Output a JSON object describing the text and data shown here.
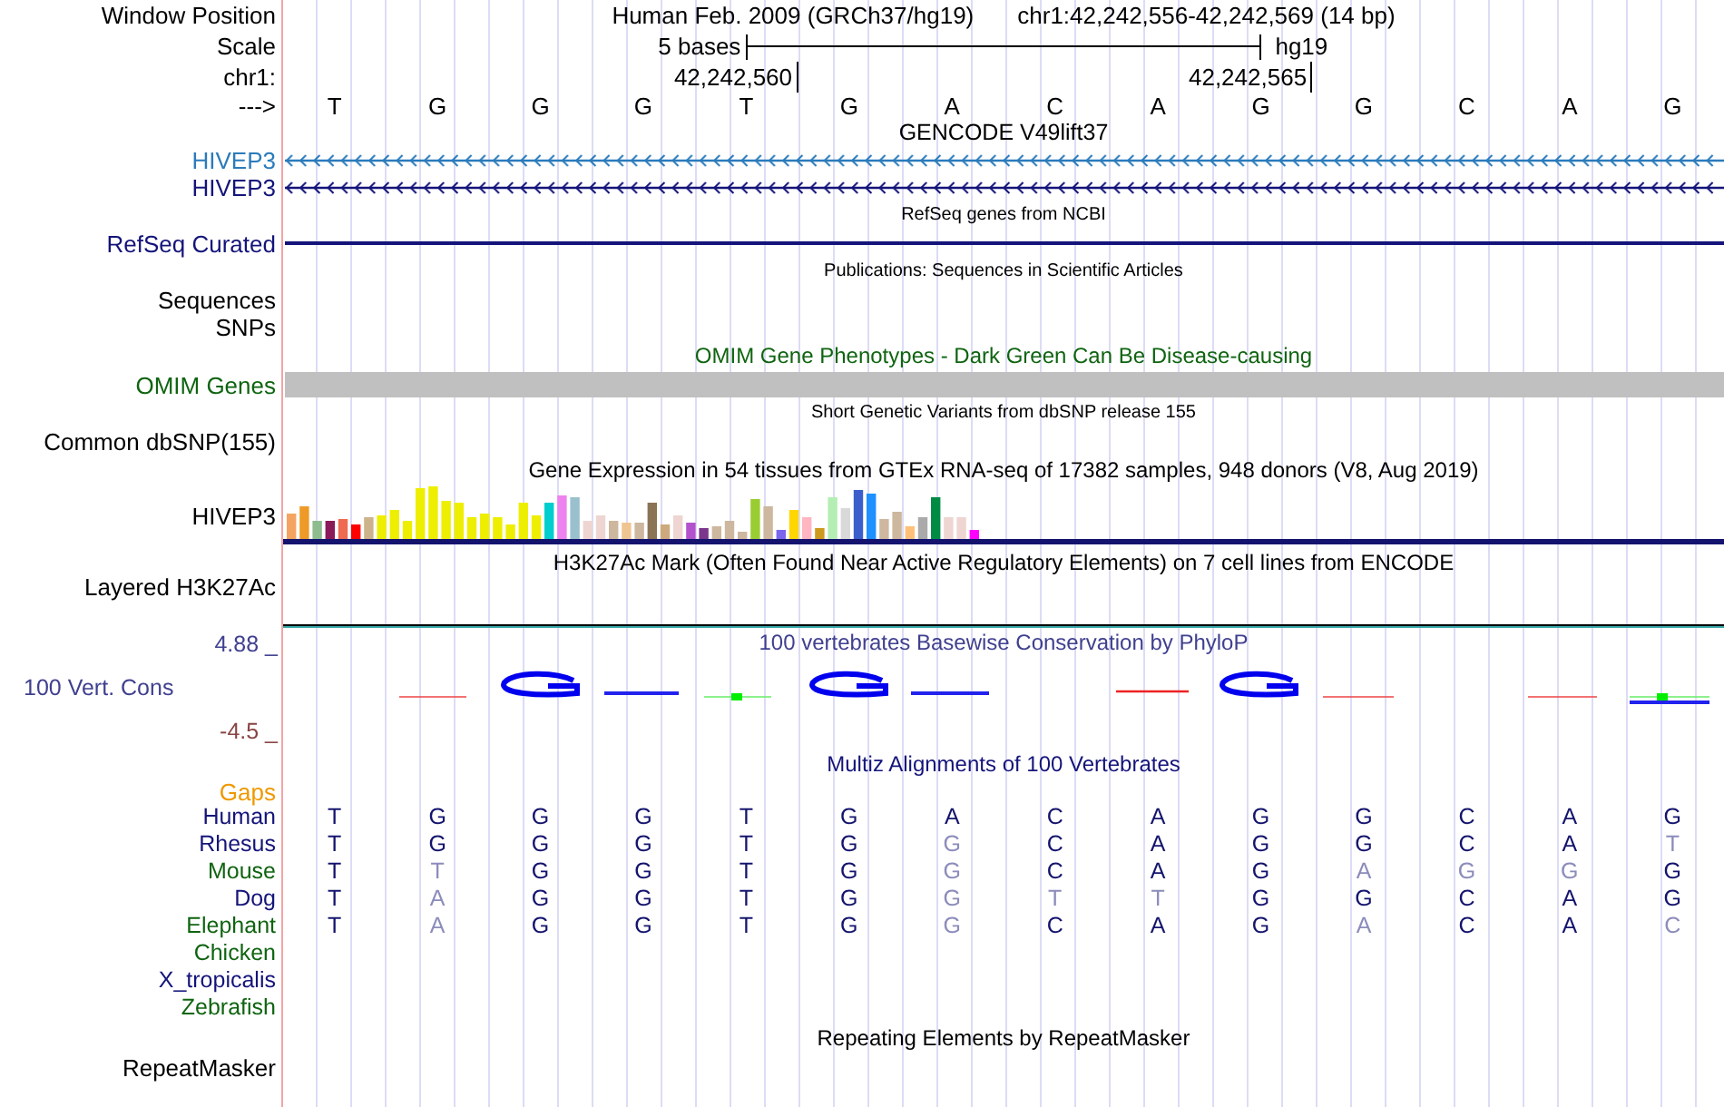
{
  "window_position": {
    "label": "Window Position",
    "assembly": "Human Feb. 2009 (GRCh37/hg19)",
    "position": "chr1:42,242,556-42,242,569 (14 bp)"
  },
  "scale": {
    "label": "Scale",
    "span": "5 bases",
    "assembly": "hg19"
  },
  "coordinates": {
    "label": "chr1:",
    "ticks": [
      "42,242,560",
      "42,242,565"
    ]
  },
  "sequence": {
    "label": "--->",
    "bases": [
      "T",
      "G",
      "G",
      "G",
      "T",
      "G",
      "A",
      "C",
      "A",
      "G",
      "G",
      "C",
      "A",
      "G"
    ]
  },
  "gencode": {
    "title": "GENCODE V49lift37",
    "genes": [
      {
        "name": "HIVEP3",
        "color": "#2b7bbb"
      },
      {
        "name": "HIVEP3",
        "color": "#14147a"
      }
    ]
  },
  "refseq": {
    "title": "RefSeq genes from NCBI",
    "label": "RefSeq Curated"
  },
  "publications": {
    "title": "Publications: Sequences in Scientific Articles",
    "labels": [
      "Sequences",
      "SNPs"
    ]
  },
  "omim": {
    "title": "OMIM Gene Phenotypes - Dark Green Can Be Disease-causing",
    "label": "OMIM Genes"
  },
  "dbsnp": {
    "title": "Short Genetic Variants from dbSNP release 155",
    "label": "Common dbSNP(155)"
  },
  "gtex": {
    "title": "Gene Expression in 54 tissues from GTEx RNA-seq of 17382 samples, 948 donors (V8, Aug 2019)",
    "label": "HIVEP3"
  },
  "h3k27ac": {
    "title": "H3K27Ac Mark (Often Found Near Active Regulatory Elements) on 7 cell lines from ENCODE",
    "label": "Layered H3K27Ac"
  },
  "conservation": {
    "title": "100 vertebrates Basewise Conservation by PhyloP",
    "label": "100 Vert. Cons",
    "max": "4.88 _",
    "min": "-4.5 _"
  },
  "multiz": {
    "title": "Multiz Alignments of 100 Vertebrates",
    "gaps_label": "Gaps",
    "species": [
      {
        "name": "Human",
        "color": "#14147a",
        "bases": [
          {
            "base": "T",
            "mismatch": false
          },
          {
            "base": "G",
            "mismatch": false
          },
          {
            "base": "G",
            "mismatch": false
          },
          {
            "base": "G",
            "mismatch": false
          },
          {
            "base": "T",
            "mismatch": false
          },
          {
            "base": "G",
            "mismatch": false
          },
          {
            "base": "A",
            "mismatch": false
          },
          {
            "base": "C",
            "mismatch": false
          },
          {
            "base": "A",
            "mismatch": false
          },
          {
            "base": "G",
            "mismatch": false
          },
          {
            "base": "G",
            "mismatch": false
          },
          {
            "base": "C",
            "mismatch": false
          },
          {
            "base": "A",
            "mismatch": false
          },
          {
            "base": "G",
            "mismatch": false
          }
        ]
      },
      {
        "name": "Rhesus",
        "color": "#14147a",
        "bases": [
          {
            "base": "T",
            "mismatch": false
          },
          {
            "base": "G",
            "mismatch": false
          },
          {
            "base": "G",
            "mismatch": false
          },
          {
            "base": "G",
            "mismatch": false
          },
          {
            "base": "T",
            "mismatch": false
          },
          {
            "base": "G",
            "mismatch": false
          },
          {
            "base": "G",
            "mismatch": true
          },
          {
            "base": "C",
            "mismatch": false
          },
          {
            "base": "A",
            "mismatch": false
          },
          {
            "base": "G",
            "mismatch": false
          },
          {
            "base": "G",
            "mismatch": false
          },
          {
            "base": "C",
            "mismatch": false
          },
          {
            "base": "A",
            "mismatch": false
          },
          {
            "base": "T",
            "mismatch": true
          }
        ]
      },
      {
        "name": "Mouse",
        "color": "#0f6410",
        "bases": [
          {
            "base": "T",
            "mismatch": false
          },
          {
            "base": "T",
            "mismatch": true
          },
          {
            "base": "G",
            "mismatch": false
          },
          {
            "base": "G",
            "mismatch": false
          },
          {
            "base": "T",
            "mismatch": false
          },
          {
            "base": "G",
            "mismatch": false
          },
          {
            "base": "G",
            "mismatch": true
          },
          {
            "base": "C",
            "mismatch": false
          },
          {
            "base": "A",
            "mismatch": false
          },
          {
            "base": "G",
            "mismatch": false
          },
          {
            "base": "A",
            "mismatch": true
          },
          {
            "base": "G",
            "mismatch": true
          },
          {
            "base": "G",
            "mismatch": true
          },
          {
            "base": "G",
            "mismatch": false
          }
        ]
      },
      {
        "name": "Dog",
        "color": "#14147a",
        "bases": [
          {
            "base": "T",
            "mismatch": false
          },
          {
            "base": "A",
            "mismatch": true
          },
          {
            "base": "G",
            "mismatch": false
          },
          {
            "base": "G",
            "mismatch": false
          },
          {
            "base": "T",
            "mismatch": false
          },
          {
            "base": "G",
            "mismatch": false
          },
          {
            "base": "G",
            "mismatch": true
          },
          {
            "base": "T",
            "mismatch": true
          },
          {
            "base": "T",
            "mismatch": true
          },
          {
            "base": "G",
            "mismatch": false
          },
          {
            "base": "G",
            "mismatch": false
          },
          {
            "base": "C",
            "mismatch": false
          },
          {
            "base": "A",
            "mismatch": false
          },
          {
            "base": "G",
            "mismatch": false
          }
        ]
      },
      {
        "name": "Elephant",
        "color": "#0f6410",
        "bases": [
          {
            "base": "T",
            "mismatch": false
          },
          {
            "base": "A",
            "mismatch": true
          },
          {
            "base": "G",
            "mismatch": false
          },
          {
            "base": "G",
            "mismatch": false
          },
          {
            "base": "T",
            "mismatch": false
          },
          {
            "base": "G",
            "mismatch": false
          },
          {
            "base": "G",
            "mismatch": true
          },
          {
            "base": "C",
            "mismatch": false
          },
          {
            "base": "A",
            "mismatch": false
          },
          {
            "base": "G",
            "mismatch": false
          },
          {
            "base": "A",
            "mismatch": true
          },
          {
            "base": "C",
            "mismatch": false
          },
          {
            "base": "A",
            "mismatch": false
          },
          {
            "base": "C",
            "mismatch": true
          }
        ]
      },
      {
        "name": "Chicken",
        "color": "#0f6410"
      },
      {
        "name": "X_tropicalis",
        "color": "#14147a"
      },
      {
        "name": "Zebrafish",
        "color": "#0f6410"
      }
    ]
  },
  "repeatmasker": {
    "title": "Repeating Elements by RepeatMasker",
    "label": "RepeatMasker"
  }
}
